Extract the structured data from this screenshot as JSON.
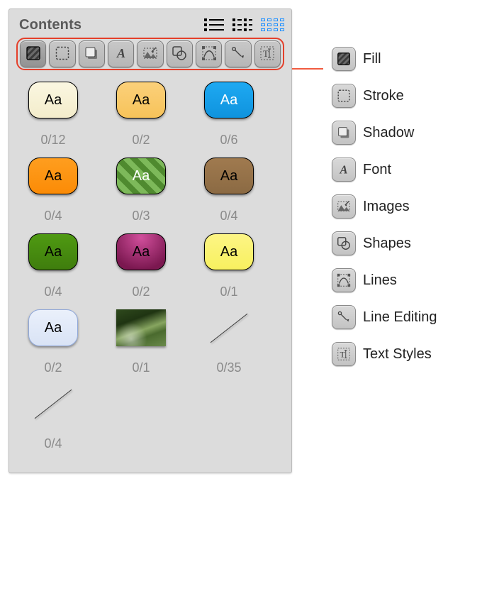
{
  "panel": {
    "title": "Contents",
    "aa": "Aa",
    "swatches": [
      {
        "fill": "linear-gradient(#fbf7e1,#f3eccb)",
        "text": "dark",
        "count": "0/12"
      },
      {
        "fill": "linear-gradient(#fbd07a,#f7c35a)",
        "text": "dark",
        "count": "0/2"
      },
      {
        "fill": "linear-gradient(#1ea9f2,#0f93de)",
        "text": "light",
        "count": "0/6"
      },
      {
        "fill": "linear-gradient(#ff9e1f,#fb8b06)",
        "text": "dark",
        "count": "0/4"
      },
      {
        "fill": "repeating-linear-gradient(45deg,#4f8a2f 0 8px,#7db95a 8px 16px),linear-gradient(#5baf3c,#3b7a22)",
        "text": "light",
        "count": "0/3",
        "plaid": true
      },
      {
        "fill": "linear-gradient(#a07a4f,#8b6a43)",
        "text": "dark",
        "count": "0/4"
      },
      {
        "fill": "linear-gradient(#4f9a12,#3f7d0d)",
        "text": "dark",
        "count": "0/4"
      },
      {
        "fill": "radial-gradient(circle at 50% 10%, #d14f9c, #7b1850 80%)",
        "text": "dark",
        "count": "0/2"
      },
      {
        "fill": "linear-gradient(#fdf585,#f7f05f)",
        "text": "dark",
        "count": "0/1"
      },
      {
        "fill": "linear-gradient(#eaf0fb,#d9e3f5)",
        "text": "dark",
        "count": "0/2",
        "thinborder": true
      },
      {
        "type": "image",
        "count": "0/1"
      },
      {
        "type": "diagonal",
        "count": "0/35"
      },
      {
        "type": "diagonal",
        "count": "0/4"
      }
    ]
  },
  "toolbar": [
    {
      "name": "fill-tool",
      "icon": "fill",
      "label": "Fill"
    },
    {
      "name": "stroke-tool",
      "icon": "stroke",
      "label": "Stroke"
    },
    {
      "name": "shadow-tool",
      "icon": "shadow",
      "label": "Shadow"
    },
    {
      "name": "font-tool",
      "icon": "font",
      "label": "Font"
    },
    {
      "name": "images-tool",
      "icon": "images",
      "label": "Images"
    },
    {
      "name": "shapes-tool",
      "icon": "shapes",
      "label": "Shapes"
    },
    {
      "name": "lines-tool",
      "icon": "lines",
      "label": "Lines"
    },
    {
      "name": "lineedit-tool",
      "icon": "lineedit",
      "label": "Line Editing"
    },
    {
      "name": "textstyle-tool",
      "icon": "textstyle",
      "label": "Text Styles"
    }
  ]
}
